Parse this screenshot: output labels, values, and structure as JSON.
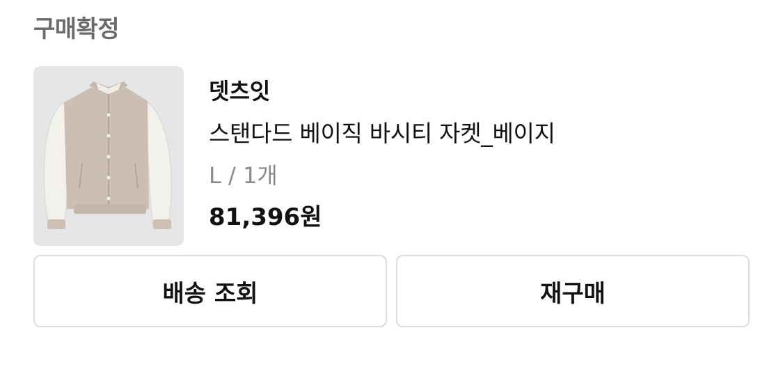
{
  "order": {
    "status": "구매확정",
    "brand": "뎃츠잇",
    "product_name": "스탠다드 베이직 바시티 자켓_베이지",
    "option": "L / 1개",
    "price": "81,396원",
    "thumbnail": "varsity-jacket-image"
  },
  "actions": {
    "track_label": "배송 조회",
    "rebuy_label": "재구매"
  }
}
